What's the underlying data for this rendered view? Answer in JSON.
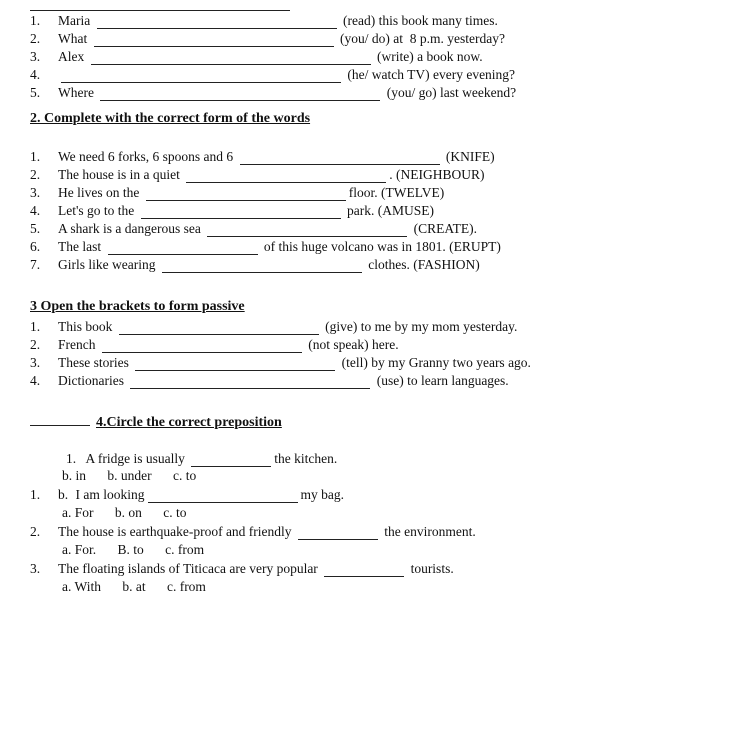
{
  "top_line": true,
  "section1": {
    "items": [
      {
        "num": "1.",
        "prefix": "Maria",
        "blank_size": "xl",
        "hint": "(read) this book many times."
      },
      {
        "num": "2.",
        "prefix": "What",
        "blank_size": "xl",
        "hint": "(you/ do) at  8 p.m. yesterday?"
      },
      {
        "num": "3.",
        "prefix": "Alex",
        "blank_size": "full",
        "hint": "(write) a book now."
      },
      {
        "num": "4.",
        "prefix": "",
        "blank_size": "full",
        "hint": "(he/ watch TV) every evening?"
      },
      {
        "num": "5.",
        "prefix": "Where",
        "blank_size": "full",
        "hint": "(you/ go) last weekend?"
      }
    ]
  },
  "section2": {
    "title": "2. Complete with the correct form of the words",
    "items": [
      {
        "num": "1.",
        "text_before": "We need 6 forks, 6 spoons and 6",
        "blank_size": "lg",
        "text_after": "(KNIFE)"
      },
      {
        "num": "2.",
        "text_before": "The house is in a quiet",
        "blank_size": "lg",
        "text_after": ". (NEIGHBOUR)"
      },
      {
        "num": "3.",
        "text_before": "He lives on the",
        "blank_size": "lg",
        "text_after": "floor. (TWELVE)"
      },
      {
        "num": "4.",
        "text_before": "Let's go to the",
        "blank_size": "lg",
        "text_after": "park. (AMUSE)"
      },
      {
        "num": "5.",
        "text_before": "A shark is a dangerous sea",
        "blank_size": "lg",
        "text_after": "(CREATE)."
      },
      {
        "num": "6.",
        "text_before": "The last",
        "blank_size": "md",
        "text_after": "of this huge volcano was in 1801. (ERUPT)"
      },
      {
        "num": "7.",
        "text_before": "Girls like wearing",
        "blank_size": "lg",
        "text_after": "clothes. (FASHION)"
      }
    ]
  },
  "section3": {
    "title": "3 Open the brackets to form passive",
    "items": [
      {
        "num": "1.",
        "text_before": "This book",
        "blank_size": "lg",
        "text_after": "(give) to me by my mom yesterday."
      },
      {
        "num": "2.",
        "text_before": "French",
        "blank_size": "lg",
        "text_after": "(not speak) here."
      },
      {
        "num": "3.",
        "text_before": "These stories",
        "blank_size": "lg",
        "text_after": "(tell) by my Granny two years ago."
      },
      {
        "num": "4.",
        "text_before": "Dictionaries",
        "blank_size": "xl",
        "text_after": "(use) to learn languages."
      }
    ]
  },
  "section4": {
    "title": "4.Circle the correct preposition",
    "items": [
      {
        "num": "1.",
        "indent": true,
        "text_before": "A fridge is usually",
        "blank_size": "sm",
        "text_after": "the kitchen.",
        "options": [
          {
            "label": "b. in"
          },
          {
            "label": "b. under"
          },
          {
            "label": "c. to"
          }
        ]
      },
      {
        "num": "1.",
        "prefix_label": "b.",
        "text_before": "I am looking",
        "blank_size": "md",
        "text_after": "my bag.",
        "options": [
          {
            "label": "a. For"
          },
          {
            "label": "b. on"
          },
          {
            "label": "c. to"
          }
        ]
      },
      {
        "num": "2.",
        "text_before": "The house is earthquake-proof and friendly",
        "blank_size": "sm",
        "text_after": "the environment.",
        "options": [
          {
            "label": "a. For."
          },
          {
            "label": "B. to"
          },
          {
            "label": "c. from"
          }
        ]
      },
      {
        "num": "3.",
        "text_before": "The floating islands of Titicaca are very popular",
        "blank_size": "sm",
        "text_after": "tourists.",
        "options": [
          {
            "label": "a. With"
          },
          {
            "label": "b. at"
          },
          {
            "label": "c. from"
          }
        ]
      }
    ]
  }
}
